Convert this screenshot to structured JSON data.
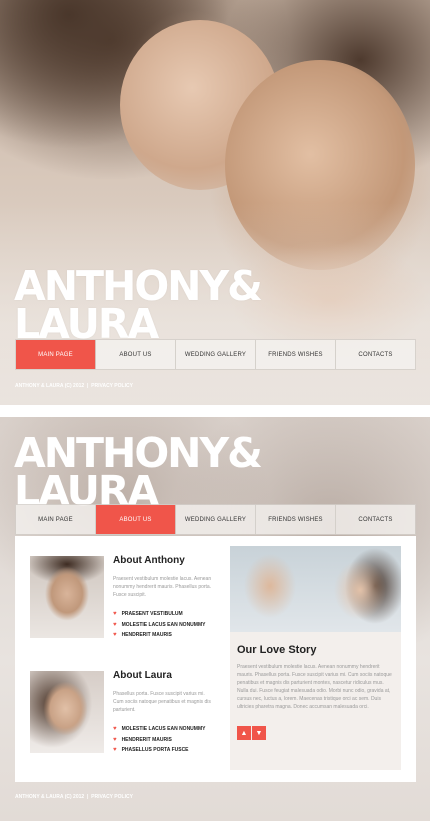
{
  "brand": {
    "line1": "ANTHONY&",
    "line2": "LAURA"
  },
  "nav": {
    "items": [
      "MAIN PAGE",
      "ABOUT US",
      "WEDDING GALLERY",
      "FRIENDS WISHES",
      "CONTACTS"
    ]
  },
  "footer": {
    "copyright": "ANTHONY & LAURA (C) 2012",
    "separator": "|",
    "privacy": "PRIVACY POLICY"
  },
  "about": {
    "anthony": {
      "name": "About Anthony",
      "description": "Praesent vestibulum molestie lacus. Aenean nonummy hendrerit mauris. Phasellus porta. Fusce suscipit.",
      "list": [
        "PRAESENT VESTIBULUM",
        "MOLESTIE LACUS EAN NONUMMY",
        "HENDRERIT MAURIS"
      ]
    },
    "laura": {
      "name": "About Laura",
      "description": "Phasellus porta. Fusce suscipit varius mi. Cum sociis natoque penatibus et magnis dis parturient.",
      "list": [
        "MOLESTIE LACUS EAN NONUMMY",
        "HENDRERIT MAURIS",
        "PHASELLUS PORTA FUSCE"
      ]
    }
  },
  "story": {
    "heading": "Our Love Story",
    "text": "Praesent vestibulum molestie lacus. Aenean nonummy hendrerit mauris. Phasellus porta. Fusce suscipit varius mi. Cum sociis natoque penatibus et magnis dis parturient montes, nascetur ridiculus mus. Nulla dui. Fusce feugiat malesuada odio. Morbi nunc odio, gravida at, cursus nec, luctus a, lorem. Maecenas tristique orci ac sem. Duis ultricies pharetra magna. Donec accumsan malesuada orci.",
    "prev_icon": "chevron-up-icon",
    "next_icon": "chevron-down-icon"
  },
  "colors": {
    "accent": "#f0554a",
    "text": "#222222",
    "muted": "#9a9a9a"
  }
}
